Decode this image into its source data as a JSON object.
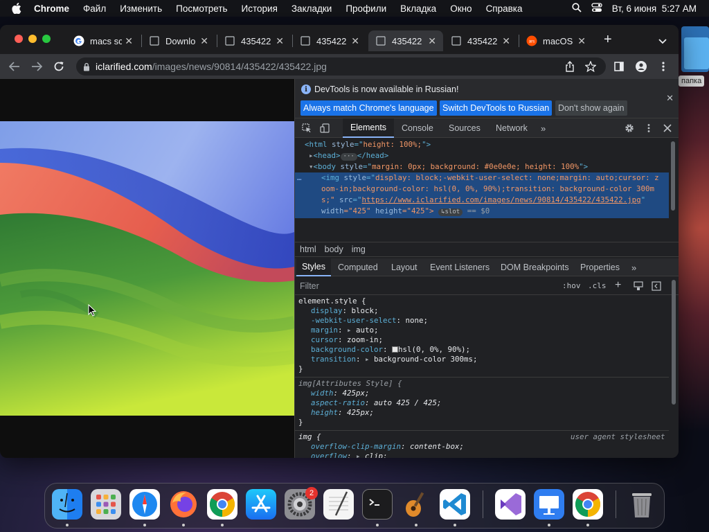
{
  "menubar": {
    "app": "Chrome",
    "items": [
      "Файл",
      "Изменить",
      "Посмотреть",
      "История",
      "Закладки",
      "Профили",
      "Вкладка",
      "Окно",
      "Справка"
    ],
    "datetime": "Вт, 6 июня  5:27 AM"
  },
  "desktop": {
    "folder_label": "папка"
  },
  "tabs": [
    {
      "title": "macs sc",
      "icon": "google-icon"
    },
    {
      "title": "Downlo",
      "icon": "page-icon"
    },
    {
      "title": "435422",
      "icon": "page-icon"
    },
    {
      "title": "435422",
      "icon": "page-icon"
    },
    {
      "title": "435422",
      "icon": "page-icon",
      "active": true
    },
    {
      "title": "435422",
      "icon": "page-icon"
    },
    {
      "title": "macOS",
      "icon": "ars-icon"
    }
  ],
  "omnibox": {
    "host": "iclarified.com",
    "path": "/images/news/90814/435422/435422.jpg"
  },
  "devtools": {
    "infobar": {
      "message": "DevTools is now available in Russian!",
      "btn_match": "Always match Chrome's language",
      "btn_switch": "Switch DevTools to Russian",
      "btn_dismiss": "Don't show again"
    },
    "tabs": [
      "Elements",
      "Console",
      "Sources",
      "Network"
    ],
    "dom": {
      "l1a": "<html ",
      "l1b": "style",
      "l1c": "=\"",
      "l1d": "height: 100%;",
      "l1e": "\">",
      "l2": "<head>",
      "l2b": "</head>",
      "l3a": "<body ",
      "l3b": "style",
      "l3c": "=\"",
      "l3d": "margin: 0px; background: #0e0e0e; height: 100%",
      "l3e": "\">",
      "l4a": "<img ",
      "l4b": "style",
      "l4c": "=\"",
      "l4d": "display: block;-webkit-user-select: none;margin: auto;cursor: z",
      "l5": "oom-in;background-color: hsl(0, 0%, 90%);transition: background-color 300m",
      "l6a": "s;\" ",
      "l6b": "src",
      "l6c": "=\"",
      "l6d": "https://www.iclarified.com/images/news/90814/435422/435422.jpg",
      "l6e": "\"",
      "l7a": "width",
      "l7b": "=\"425\" ",
      "l7c": "height",
      "l7d": "=\"425\">",
      "slot": "slot",
      "eq": " == $0"
    },
    "breadcrumbs": [
      "html",
      "body",
      "img"
    ],
    "subtabs": [
      "Styles",
      "Computed",
      "Layout",
      "Event Listeners",
      "DOM Breakpoints",
      "Properties"
    ],
    "filter": {
      "placeholder": "Filter",
      "hov": ":hov",
      "cls": ".cls"
    },
    "rules": {
      "r1_sel": "element.style {",
      "r1": [
        {
          "p": "display",
          "v": "block;"
        },
        {
          "p": "-webkit-user-select",
          "v": "none;"
        },
        {
          "p": "margin",
          "v": "auto;"
        },
        {
          "p": "cursor",
          "v": "zoom-in;"
        },
        {
          "p": "background-color",
          "v": "hsl(0, 0%, 90%);"
        },
        {
          "p": "transition",
          "v": "background-color 300ms;"
        }
      ],
      "r2_sel": "img[Attributes Style] {",
      "r2": [
        {
          "p": "width",
          "v": "425px;"
        },
        {
          "p": "aspect-ratio",
          "v": "auto 425 / 425;"
        },
        {
          "p": "height",
          "v": "425px;"
        }
      ],
      "r3_sel": "img {",
      "r3_origin": "user agent stylesheet",
      "r3": [
        {
          "p": "overflow-clip-margin",
          "v": "content-box;"
        },
        {
          "p": "overflow",
          "v": "clip;"
        }
      ],
      "close_brace": "}"
    }
  },
  "dock": {
    "apps": [
      "finder-icon",
      "launchpad-icon",
      "safari-icon",
      "firefox-icon",
      "chrome-icon",
      "app-store-icon",
      "system-settings-icon",
      "textedit-icon",
      "terminal-icon",
      "garageband-icon",
      "vscode-icon",
      "visual-studio-icon",
      "keynote-icon",
      "chrome-canary-icon",
      "trash-icon"
    ],
    "badge": "2"
  }
}
